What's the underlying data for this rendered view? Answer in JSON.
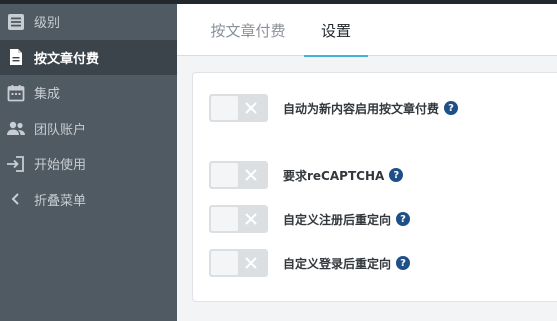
{
  "sidebar": {
    "items": [
      {
        "label": "级别",
        "icon": "list-icon",
        "active": false
      },
      {
        "label": "按文章付费",
        "icon": "document-icon",
        "active": true
      },
      {
        "label": "集成",
        "icon": "calendar-icon",
        "active": false
      },
      {
        "label": "团队账户",
        "icon": "users-icon",
        "active": false
      },
      {
        "label": "开始使用",
        "icon": "sign-in-icon",
        "active": false
      },
      {
        "label": "折叠菜单",
        "icon": "chevron-left-icon",
        "active": false
      }
    ]
  },
  "tabs": [
    {
      "label": "按文章付费",
      "active": false
    },
    {
      "label": "设置",
      "active": true
    }
  ],
  "settings": [
    {
      "label": "自动为新内容启用按文章付费",
      "help": "?",
      "enabled": false
    },
    {
      "label": "要求reCAPTCHA",
      "help": "?",
      "enabled": false
    },
    {
      "label": "自定义注册后重定向",
      "help": "?",
      "enabled": false
    },
    {
      "label": "自定义登录后重定向",
      "help": "?",
      "enabled": false
    }
  ],
  "colors": {
    "sidebar_bg": "#505a62",
    "sidebar_active_bg": "#3b444b",
    "tab_underline": "#42b3d6",
    "help_icon": "#1e4f86",
    "toggle_off": "#dcdfe2"
  }
}
